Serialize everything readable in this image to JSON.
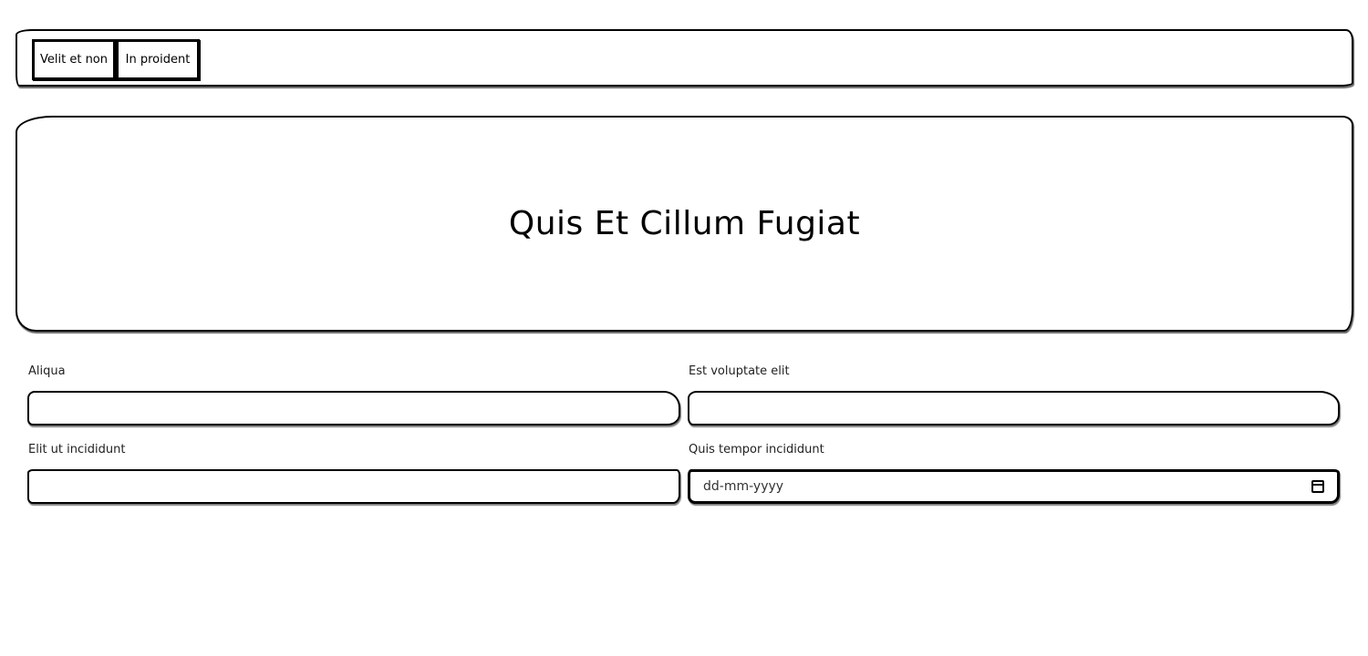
{
  "nav": {
    "buttons": [
      {
        "label": "Velit et non"
      },
      {
        "label": "In proident"
      }
    ]
  },
  "hero": {
    "title": "Quis Et Cillum Fugiat"
  },
  "form": {
    "fields": [
      {
        "label": "Aliqua",
        "value": "",
        "type": "text"
      },
      {
        "label": "Est voluptate elit",
        "value": "",
        "type": "text"
      },
      {
        "label": "Elit ut incididunt",
        "value": "",
        "type": "text"
      },
      {
        "label": "Quis tempor incididunt",
        "value": "",
        "placeholder": "dd-mm-yyyy",
        "type": "date",
        "icon": "calendar-icon"
      }
    ]
  }
}
